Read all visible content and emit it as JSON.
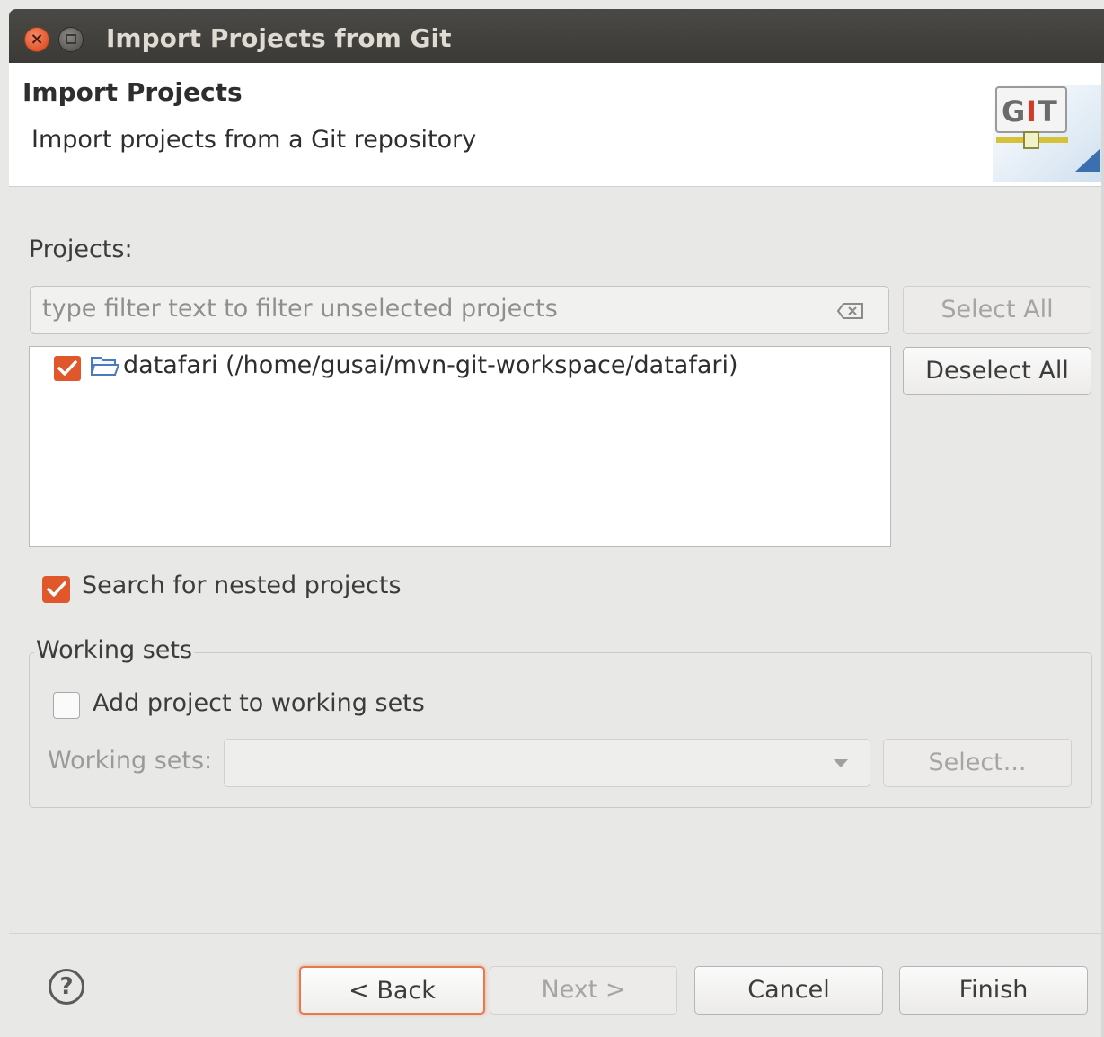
{
  "window": {
    "title": "Import Projects from Git"
  },
  "header": {
    "title": "Import Projects",
    "description": "Import projects from a Git repository",
    "logo_text": "GIT"
  },
  "projects": {
    "label": "Projects:",
    "filter_placeholder": "type filter text to filter unselected projects",
    "select_all_label": "Select All",
    "deselect_all_label": "Deselect All",
    "items": [
      {
        "label": "datafari (/home/gusai/mvn-git-workspace/datafari)",
        "checked": true
      }
    ]
  },
  "nested": {
    "label": "Search for nested projects",
    "checked": true
  },
  "working_sets": {
    "group_title": "Working sets",
    "add_label": "Add project to working sets",
    "add_checked": false,
    "sets_label": "Working sets:",
    "sets_value": "",
    "select_label": "Select..."
  },
  "footer": {
    "help_icon": "?",
    "back_label": "< Back",
    "next_label": "Next >",
    "cancel_label": "Cancel",
    "finish_label": "Finish"
  },
  "colors": {
    "accent": "#e0572c",
    "titlebar": "#3b3a36"
  }
}
